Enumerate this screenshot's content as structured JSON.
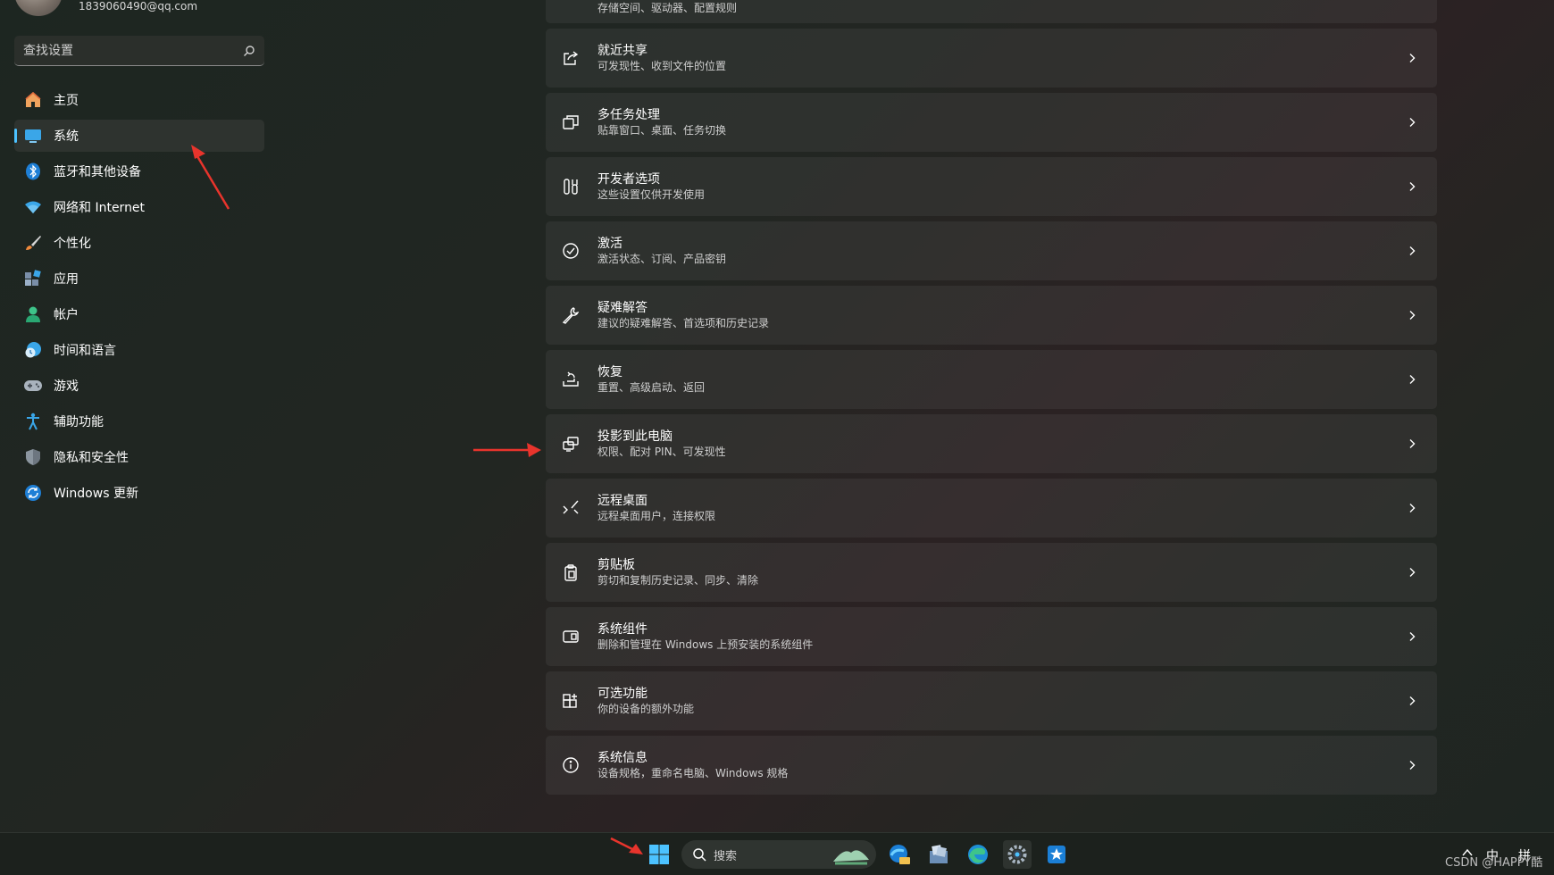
{
  "sidebar": {
    "account_email": "1839060490@qq.com",
    "search_placeholder": "查找设置",
    "items": [
      {
        "label": "主页",
        "icon": "home-icon"
      },
      {
        "label": "系统",
        "icon": "system-monitor-icon",
        "active": true
      },
      {
        "label": "蓝牙和其他设备",
        "icon": "bluetooth-icon"
      },
      {
        "label": "网络和 Internet",
        "icon": "wifi-icon"
      },
      {
        "label": "个性化",
        "icon": "paintbrush-icon"
      },
      {
        "label": "应用",
        "icon": "apps-icon"
      },
      {
        "label": "帐户",
        "icon": "account-icon"
      },
      {
        "label": "时间和语言",
        "icon": "time-language-icon"
      },
      {
        "label": "游戏",
        "icon": "gamepad-icon"
      },
      {
        "label": "辅助功能",
        "icon": "accessibility-icon"
      },
      {
        "label": "隐私和安全性",
        "icon": "shield-icon"
      },
      {
        "label": "Windows 更新",
        "icon": "update-icon"
      }
    ]
  },
  "main": {
    "partial_top_subtitle": "存储空间、驱动器、配置规则",
    "cards": [
      {
        "title": "就近共享",
        "subtitle": "可发现性、收到文件的位置",
        "icon": "share-icon"
      },
      {
        "title": "多任务处理",
        "subtitle": "贴靠窗口、桌面、任务切换",
        "icon": "multitask-icon"
      },
      {
        "title": "开发者选项",
        "subtitle": "这些设置仅供开发使用",
        "icon": "developer-tools-icon"
      },
      {
        "title": "激活",
        "subtitle": "激活状态、订阅、产品密钥",
        "icon": "activation-check-icon"
      },
      {
        "title": "疑难解答",
        "subtitle": "建议的疑难解答、首选项和历史记录",
        "icon": "wrench-icon"
      },
      {
        "title": "恢复",
        "subtitle": "重置、高级启动、返回",
        "icon": "recovery-icon"
      },
      {
        "title": "投影到此电脑",
        "subtitle": "权限、配对 PIN、可发现性",
        "icon": "project-icon"
      },
      {
        "title": "远程桌面",
        "subtitle": "远程桌面用户，连接权限",
        "icon": "remote-desktop-icon"
      },
      {
        "title": "剪贴板",
        "subtitle": "剪切和复制历史记录、同步、清除",
        "icon": "clipboard-icon"
      },
      {
        "title": "系统组件",
        "subtitle": "删除和管理在 Windows 上预安装的系统组件",
        "icon": "components-icon"
      },
      {
        "title": "可选功能",
        "subtitle": "你的设备的额外功能",
        "icon": "optional-features-icon"
      },
      {
        "title": "系统信息",
        "subtitle": "设备规格，重命名电脑、Windows 规格",
        "icon": "info-icon"
      }
    ]
  },
  "taskbar": {
    "search_label": "搜索",
    "ime_lang": "中",
    "ime_mode": "拼",
    "watermark": "CSDN @HAPPY酷",
    "apps": [
      "start-icon",
      "edge-beta-icon",
      "file-manager-icon",
      "edge-icon",
      "settings-icon",
      "pinned-app-icon"
    ]
  },
  "colors": {
    "accent": "#4cc2ff",
    "annotation_arrow": "#e8342c",
    "card_bg": "#2a2f2b"
  }
}
